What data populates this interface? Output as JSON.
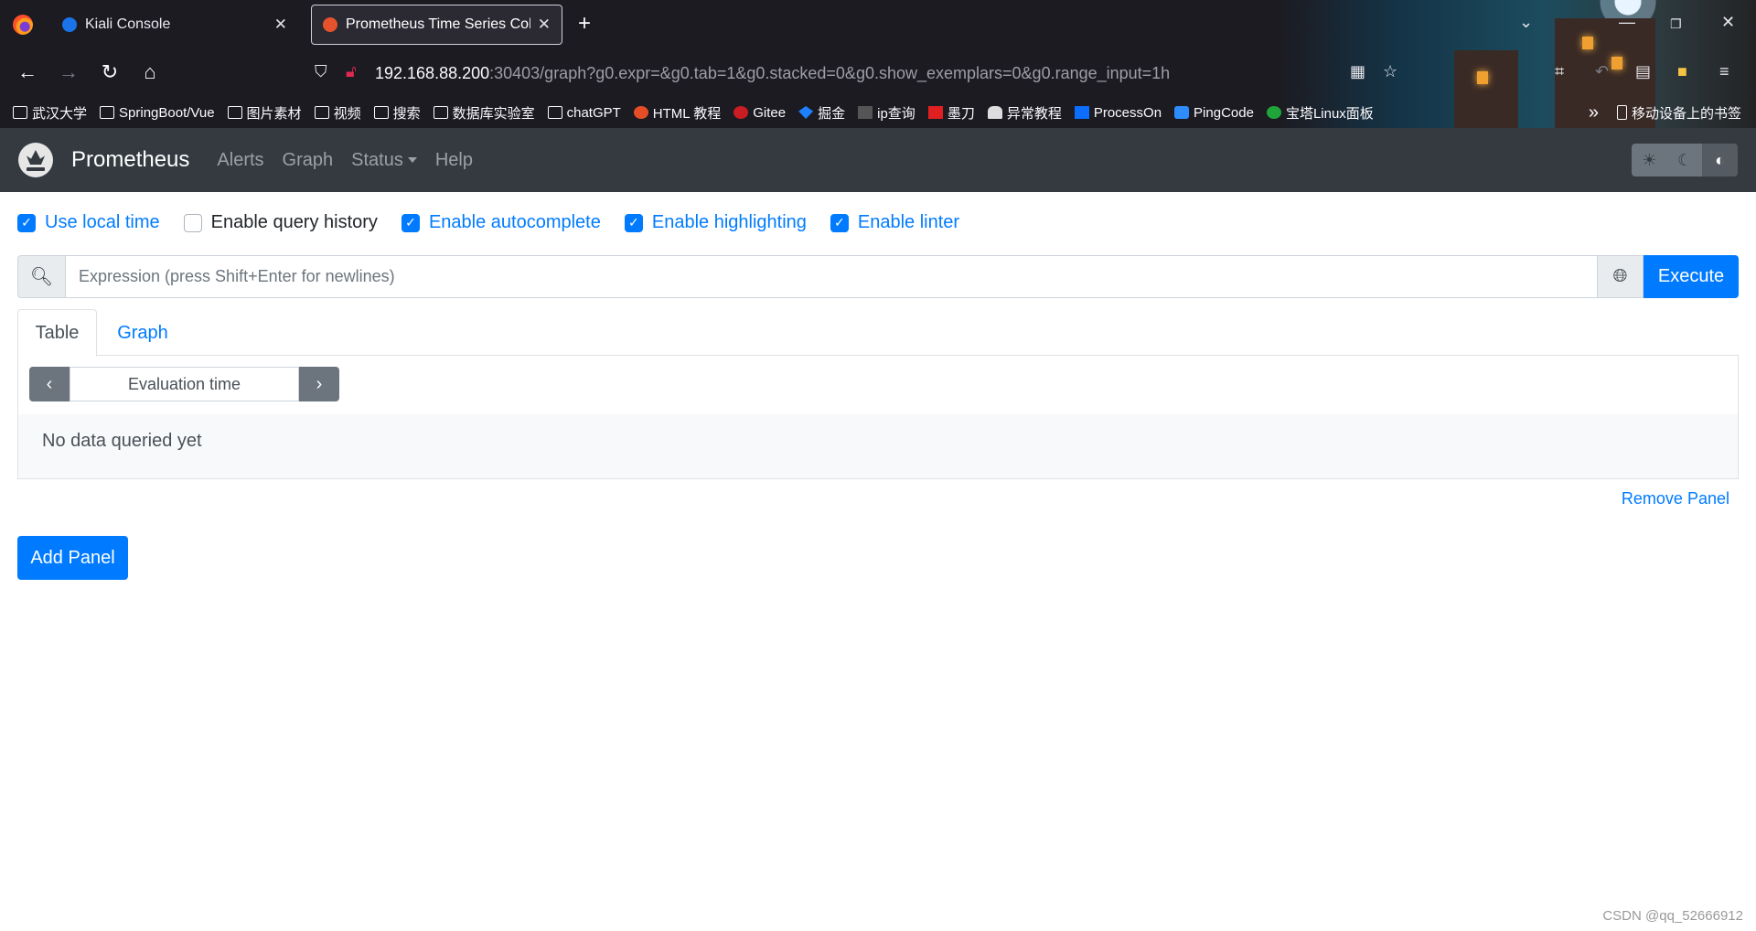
{
  "browser": {
    "tabs": [
      {
        "title": "Kiali Console",
        "favicon_color": "#1a73e8"
      },
      {
        "title": "Prometheus Time Series Coll",
        "favicon_color": "#e6522c"
      }
    ],
    "url_host": "192.168.88.200",
    "url_rest": ":30403/graph?g0.expr=&g0.tab=1&g0.stacked=0&g0.show_exemplars=0&g0.range_input=1h",
    "bookmarks": [
      {
        "label": "武汉大学",
        "icon": "folder-icon"
      },
      {
        "label": "SpringBoot/Vue",
        "icon": "folder-icon"
      },
      {
        "label": "图片素材",
        "icon": "folder-icon"
      },
      {
        "label": "视频",
        "icon": "folder-icon"
      },
      {
        "label": "搜索",
        "icon": "folder-icon"
      },
      {
        "label": "数据库实验室",
        "icon": "folder-icon"
      },
      {
        "label": "chatGPT",
        "icon": "folder-icon"
      },
      {
        "label": "HTML 教程",
        "icon": "html-icon",
        "color": "#e44d26"
      },
      {
        "label": "Gitee",
        "icon": "gitee-icon",
        "color": "#c71d23"
      },
      {
        "label": "掘金",
        "icon": "juejin-icon",
        "color": "#1e80ff"
      },
      {
        "label": "ip查询",
        "icon": "ip-icon",
        "color": "#555555"
      },
      {
        "label": "墨刀",
        "icon": "modao-icon",
        "color": "#e02020"
      },
      {
        "label": "异常教程",
        "icon": "hand-icon",
        "color": "#dddddd"
      },
      {
        "label": "ProcessOn",
        "icon": "processon-icon",
        "color": "#0c6dfe"
      },
      {
        "label": "PingCode",
        "icon": "pingcode-icon",
        "color": "#2f8cff"
      },
      {
        "label": "宝塔Linux面板",
        "icon": "baota-icon",
        "color": "#20a53a"
      }
    ],
    "bookmarks_other": "移动设备上的书签"
  },
  "prometheus": {
    "brand": "Prometheus",
    "nav": [
      "Alerts",
      "Graph",
      "Status",
      "Help"
    ],
    "options": [
      {
        "label": "Use local time",
        "checked": true
      },
      {
        "label": "Enable query history",
        "checked": false
      },
      {
        "label": "Enable autocomplete",
        "checked": true
      },
      {
        "label": "Enable highlighting",
        "checked": true
      },
      {
        "label": "Enable linter",
        "checked": true
      }
    ],
    "expression_placeholder": "Expression (press Shift+Enter for newlines)",
    "execute_label": "Execute",
    "tabs": [
      "Table",
      "Graph"
    ],
    "eval_time_placeholder": "Evaluation time",
    "no_data": "No data queried yet",
    "remove_panel": "Remove Panel",
    "add_panel": "Add Panel"
  },
  "watermark": "CSDN @qq_52666912",
  "colors": {
    "primary": "#007bff",
    "navbar": "#343a40"
  }
}
